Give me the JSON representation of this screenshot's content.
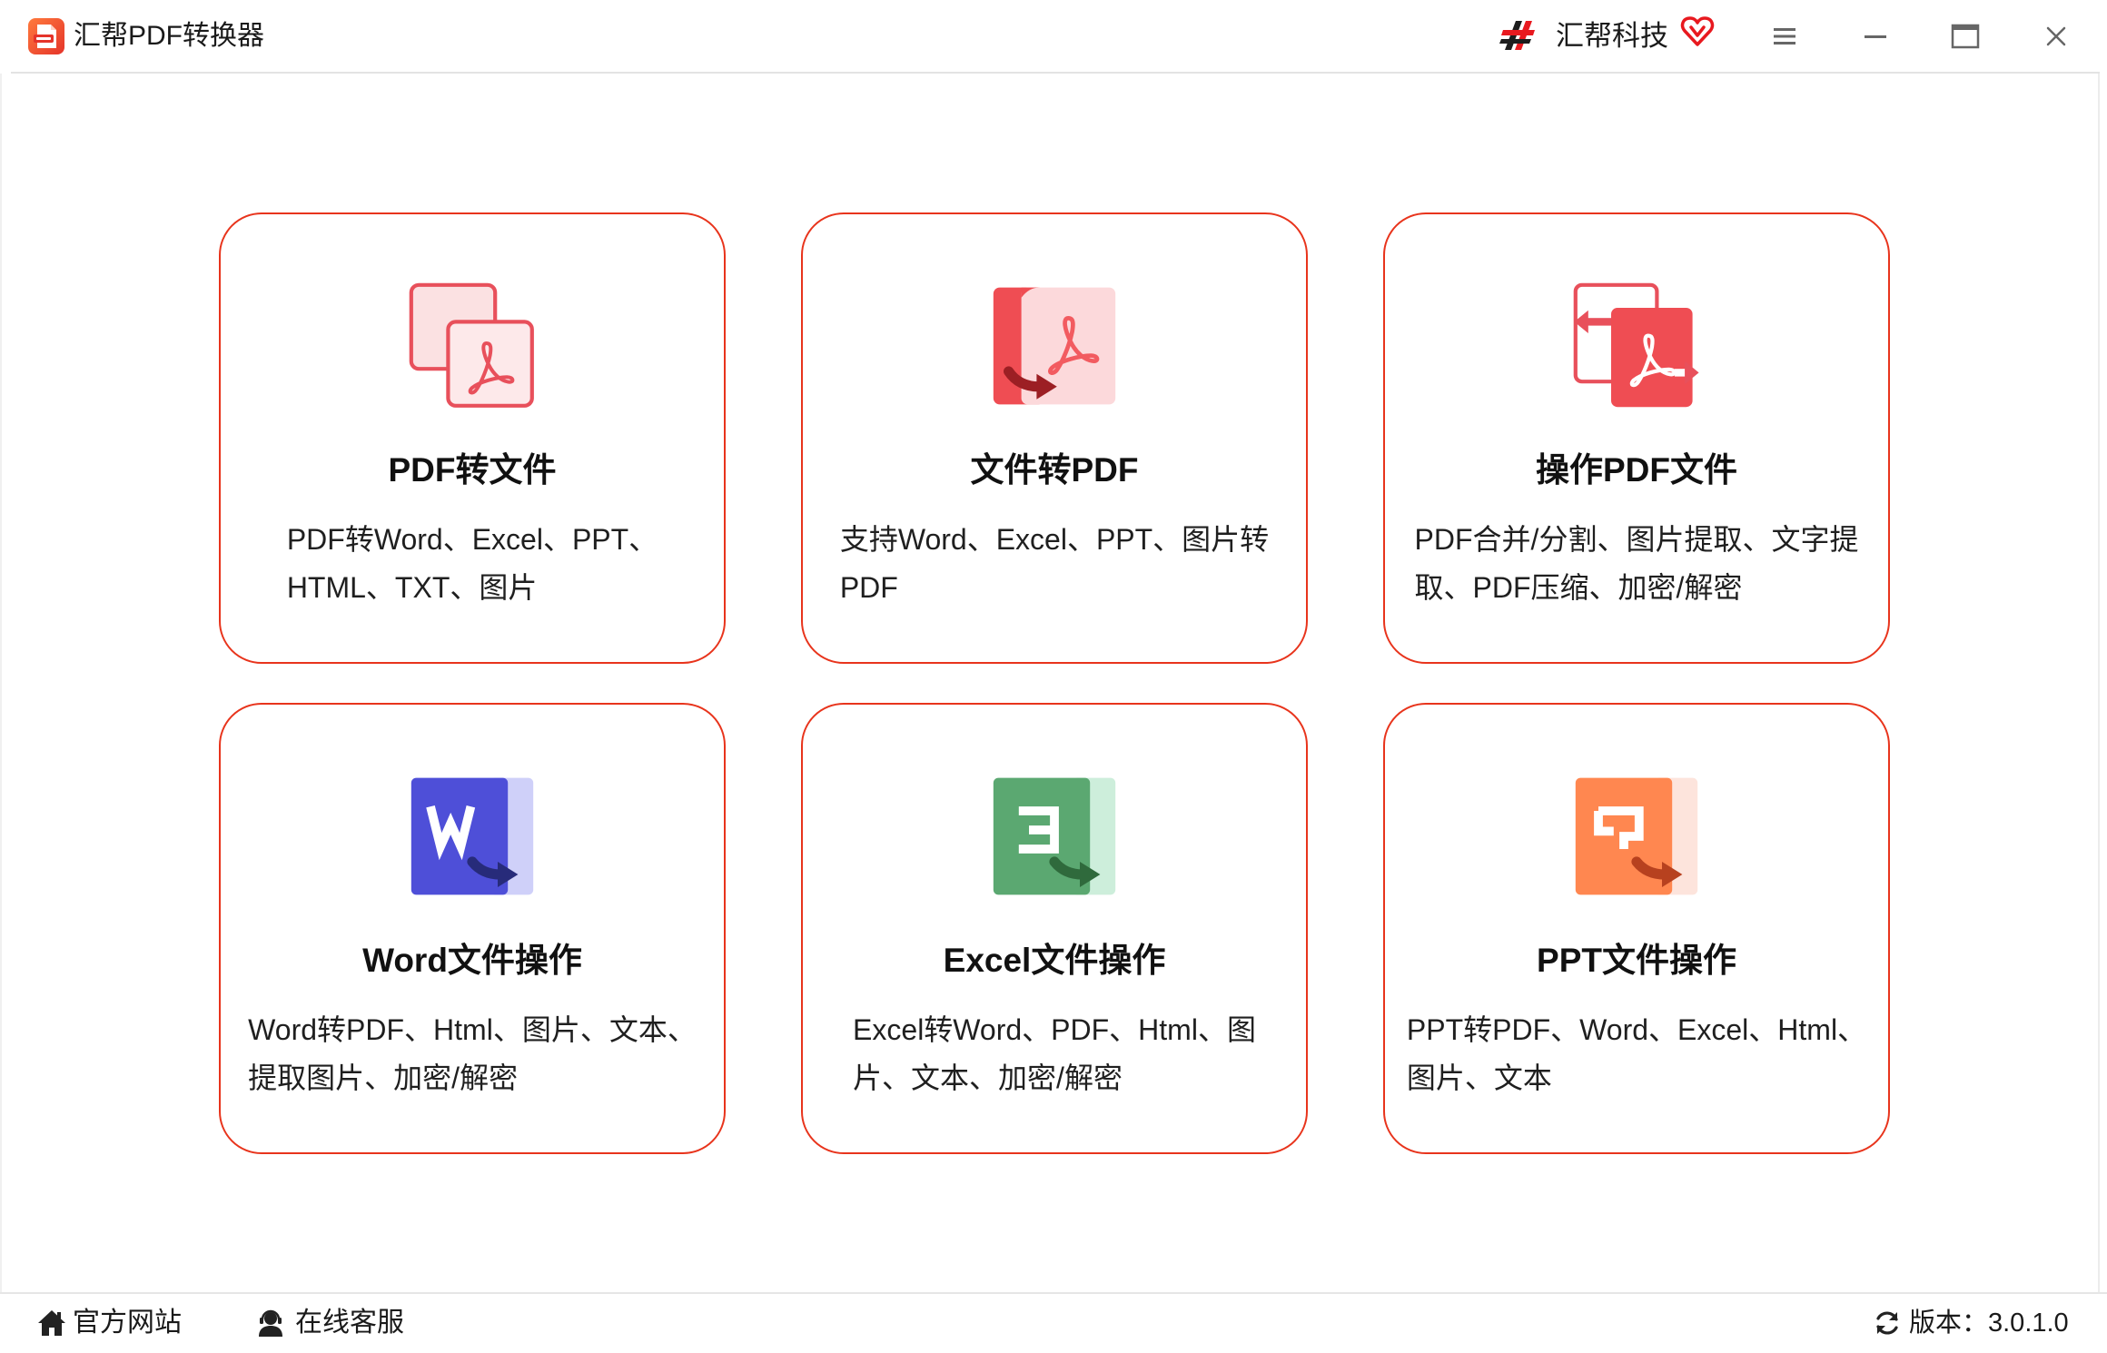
{
  "window": {
    "title": "汇帮PDF转换器"
  },
  "brand": {
    "name": "汇帮科技"
  },
  "icons": {
    "app": "pdf-app-icon",
    "brand_logo": "huibang-logo-icon",
    "brand_badge": "heart-badge-icon",
    "menu": "menu-icon",
    "minimize": "minimize-icon",
    "maximize": "maximize-icon",
    "close": "close-icon",
    "website": "home-icon",
    "support": "customer-service-icon",
    "version": "refresh-icon"
  },
  "colors": {
    "card_border": "#e8341c",
    "pdf_red": "#ef4d53",
    "pdf_pink": "#fcd9db",
    "word_blue": "#4e4fd8",
    "excel_green": "#5ba871",
    "ppt_orange": "#ff8750",
    "brand_red": "#e8191f"
  },
  "cards": [
    {
      "title": "PDF转文件",
      "icon": "pdf-to-file-icon",
      "desc": [
        "PDF转Word、Excel、PPT、",
        "HTML、TXT、图片"
      ]
    },
    {
      "title": "文件转PDF",
      "icon": "file-to-pdf-icon",
      "desc": [
        "支持Word、Excel、PPT、图片转",
        "PDF"
      ]
    },
    {
      "title": "操作PDF文件",
      "icon": "pdf-operations-icon",
      "desc": [
        "PDF合并/分割、图片提取、文字提",
        "取、PDF压缩、加密/解密"
      ]
    },
    {
      "title": "Word文件操作",
      "icon": "word-file-icon",
      "desc": [
        "Word转PDF、Html、图片、文本、",
        "提取图片、加密/解密"
      ]
    },
    {
      "title": "Excel文件操作",
      "icon": "excel-file-icon",
      "desc": [
        "Excel转Word、PDF、Html、图",
        "片、文本、加密/解密"
      ]
    },
    {
      "title": "PPT文件操作",
      "icon": "ppt-file-icon",
      "desc": [
        "PPT转PDF、Word、Excel、Html、",
        "图片、文本"
      ]
    }
  ],
  "footer": {
    "website": "官方网站",
    "support": "在线客服",
    "version": "版本：3.0.1.0"
  }
}
